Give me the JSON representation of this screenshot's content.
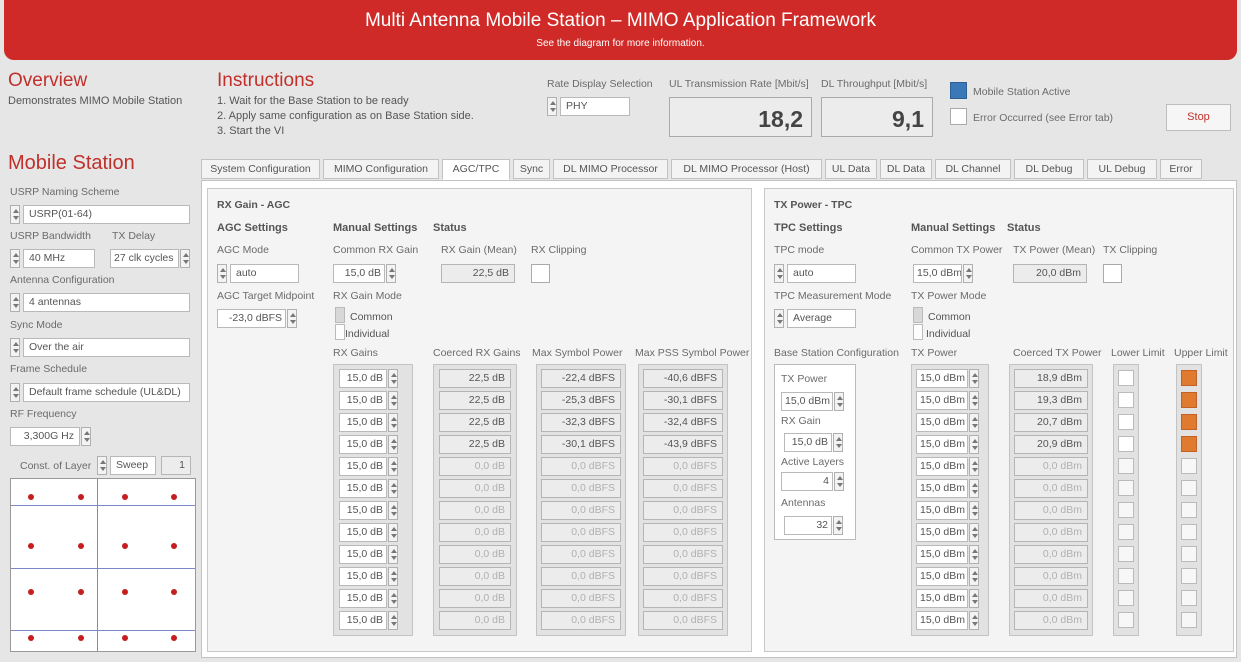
{
  "header": {
    "title": "Multi Antenna Mobile Station – MIMO Application Framework",
    "subtitle": "See the diagram for more information."
  },
  "overview": {
    "title": "Overview",
    "text": "Demonstrates MIMO Mobile Station"
  },
  "instructions": {
    "title": "Instructions",
    "steps": [
      "1. Wait for the Base Station to be ready",
      "2. Apply same configuration as on Base Station side.",
      "3. Start the VI"
    ]
  },
  "rate": {
    "label": "Rate Display Selection",
    "value": "PHY"
  },
  "ul_rate": {
    "label": "UL Transmission Rate [Mbit/s]",
    "value": "18,2"
  },
  "dl_rate": {
    "label": "DL Throughput [Mbit/s]",
    "value": "9,1"
  },
  "status": {
    "ms_active": "Mobile Station Active",
    "error": "Error Occurred (see Error tab)",
    "colors": {
      "ms_active": "#3b78b8"
    }
  },
  "stop_label": "Stop",
  "ms": {
    "title": "Mobile Station",
    "naming_label": "USRP Naming Scheme",
    "naming_value": "USRP(01-64)",
    "bw_label": "USRP Bandwidth",
    "bw_value": "40 MHz",
    "txdelay_label": "TX Delay",
    "txdelay_value": "27 clk cycles",
    "antcfg_label": "Antenna Configuration",
    "antcfg_value": "4 antennas",
    "sync_label": "Sync Mode",
    "sync_value": "Over the air",
    "frame_label": "Frame Schedule",
    "frame_value": "Default frame schedule (UL&DL)",
    "rf_label": "RF Frequency",
    "rf_value": "3,300G Hz",
    "const_label": "Const. of Layer",
    "sweep_value": "Sweep",
    "layer_value": "1"
  },
  "tabs": [
    "System Configuration",
    "MIMO Configuration",
    "AGC/TPC",
    "Sync",
    "DL MIMO Processor",
    "DL MIMO Processor (Host)",
    "UL Data",
    "DL Data",
    "DL Channel",
    "DL Debug",
    "UL Debug",
    "Error"
  ],
  "agc": {
    "section": "RX Gain - AGC",
    "settings_title": "AGC Settings",
    "manual_title": "Manual Settings",
    "status_title": "Status",
    "mode_label": "AGC Mode",
    "mode_value": "auto",
    "common_rx_label": "Common RX Gain",
    "common_rx_value": "15,0 dB",
    "rx_mean_label": "RX Gain (Mean)",
    "rx_mean_value": "22,5 dB",
    "clip_label": "RX Clipping",
    "target_label": "AGC Target Midpoint",
    "target_value": "-23,0 dBFS",
    "gain_mode_label": "RX Gain Mode",
    "mode_common": "Common",
    "mode_individual": "Individual",
    "col_rx": "RX Gains",
    "col_coerced": "Coerced RX Gains",
    "col_max": "Max Symbol Power",
    "col_pss": "Max PSS Symbol Power",
    "rx_gains": [
      "15,0 dB",
      "15,0 dB",
      "15,0 dB",
      "15,0 dB",
      "15,0 dB",
      "15,0 dB",
      "15,0 dB",
      "15,0 dB",
      "15,0 dB",
      "15,0 dB",
      "15,0 dB",
      "15,0 dB"
    ],
    "coerced": [
      "22,5 dB",
      "22,5 dB",
      "22,5 dB",
      "22,5 dB",
      "0,0 dB",
      "0,0 dB",
      "0,0 dB",
      "0,0 dB",
      "0,0 dB",
      "0,0 dB",
      "0,0 dB",
      "0,0 dB"
    ],
    "max_sym": [
      "-22,4 dBFS",
      "-25,3 dBFS",
      "-32,3 dBFS",
      "-30,1 dBFS",
      "0,0 dBFS",
      "0,0 dBFS",
      "0,0 dBFS",
      "0,0 dBFS",
      "0,0 dBFS",
      "0,0 dBFS",
      "0,0 dBFS",
      "0,0 dBFS"
    ],
    "max_pss": [
      "-40,6 dBFS",
      "-30,1 dBFS",
      "-32,4 dBFS",
      "-43,9 dBFS",
      "0,0 dBFS",
      "0,0 dBFS",
      "0,0 dBFS",
      "0,0 dBFS",
      "0,0 dBFS",
      "0,0 dBFS",
      "0,0 dBFS",
      "0,0 dBFS"
    ]
  },
  "tpc": {
    "section": "TX Power - TPC",
    "settings_title": "TPC Settings",
    "manual_title": "Manual Settings",
    "status_title": "Status",
    "mode_label": "TPC mode",
    "mode_value": "auto",
    "common_tx_label": "Common TX Power",
    "common_tx_value": "15,0 dBm",
    "tx_mean_label": "TX Power (Mean)",
    "tx_mean_value": "20,0 dBm",
    "clip_label": "TX Clipping",
    "meas_label": "TPC Measurement Mode",
    "meas_value": "Average",
    "pmode_label": "TX Power Mode",
    "mode_common": "Common",
    "mode_individual": "Individual",
    "bs_label": "Base Station Configuration",
    "bs_txp_label": "TX Power",
    "bs_txp_value": "15,0 dBm",
    "bs_rxg_label": "RX Gain",
    "bs_rxg_value": "15,0 dB",
    "bs_layers_label": "Active Layers",
    "bs_layers_value": "4",
    "bs_ant_label": "Antennas",
    "bs_ant_value": "32",
    "col_tx": "TX Power",
    "col_coerced": "Coerced TX Power",
    "col_lower": "Lower Limit",
    "col_upper": "Upper Limit",
    "tx_power": [
      "15,0 dBm",
      "15,0 dBm",
      "15,0 dBm",
      "15,0 dBm",
      "15,0 dBm",
      "15,0 dBm",
      "15,0 dBm",
      "15,0 dBm",
      "15,0 dBm",
      "15,0 dBm",
      "15,0 dBm",
      "15,0 dBm"
    ],
    "coerced": [
      "18,9 dBm",
      "19,3 dBm",
      "20,7 dBm",
      "20,9 dBm",
      "0,0 dBm",
      "0,0 dBm",
      "0,0 dBm",
      "0,0 dBm",
      "0,0 dBm",
      "0,0 dBm",
      "0,0 dBm",
      "0,0 dBm"
    ],
    "lower_on": [
      false,
      false,
      false,
      false
    ],
    "upper_on": [
      true,
      true,
      true,
      true
    ],
    "colors": {
      "upper_on": "#e07a2e"
    }
  }
}
